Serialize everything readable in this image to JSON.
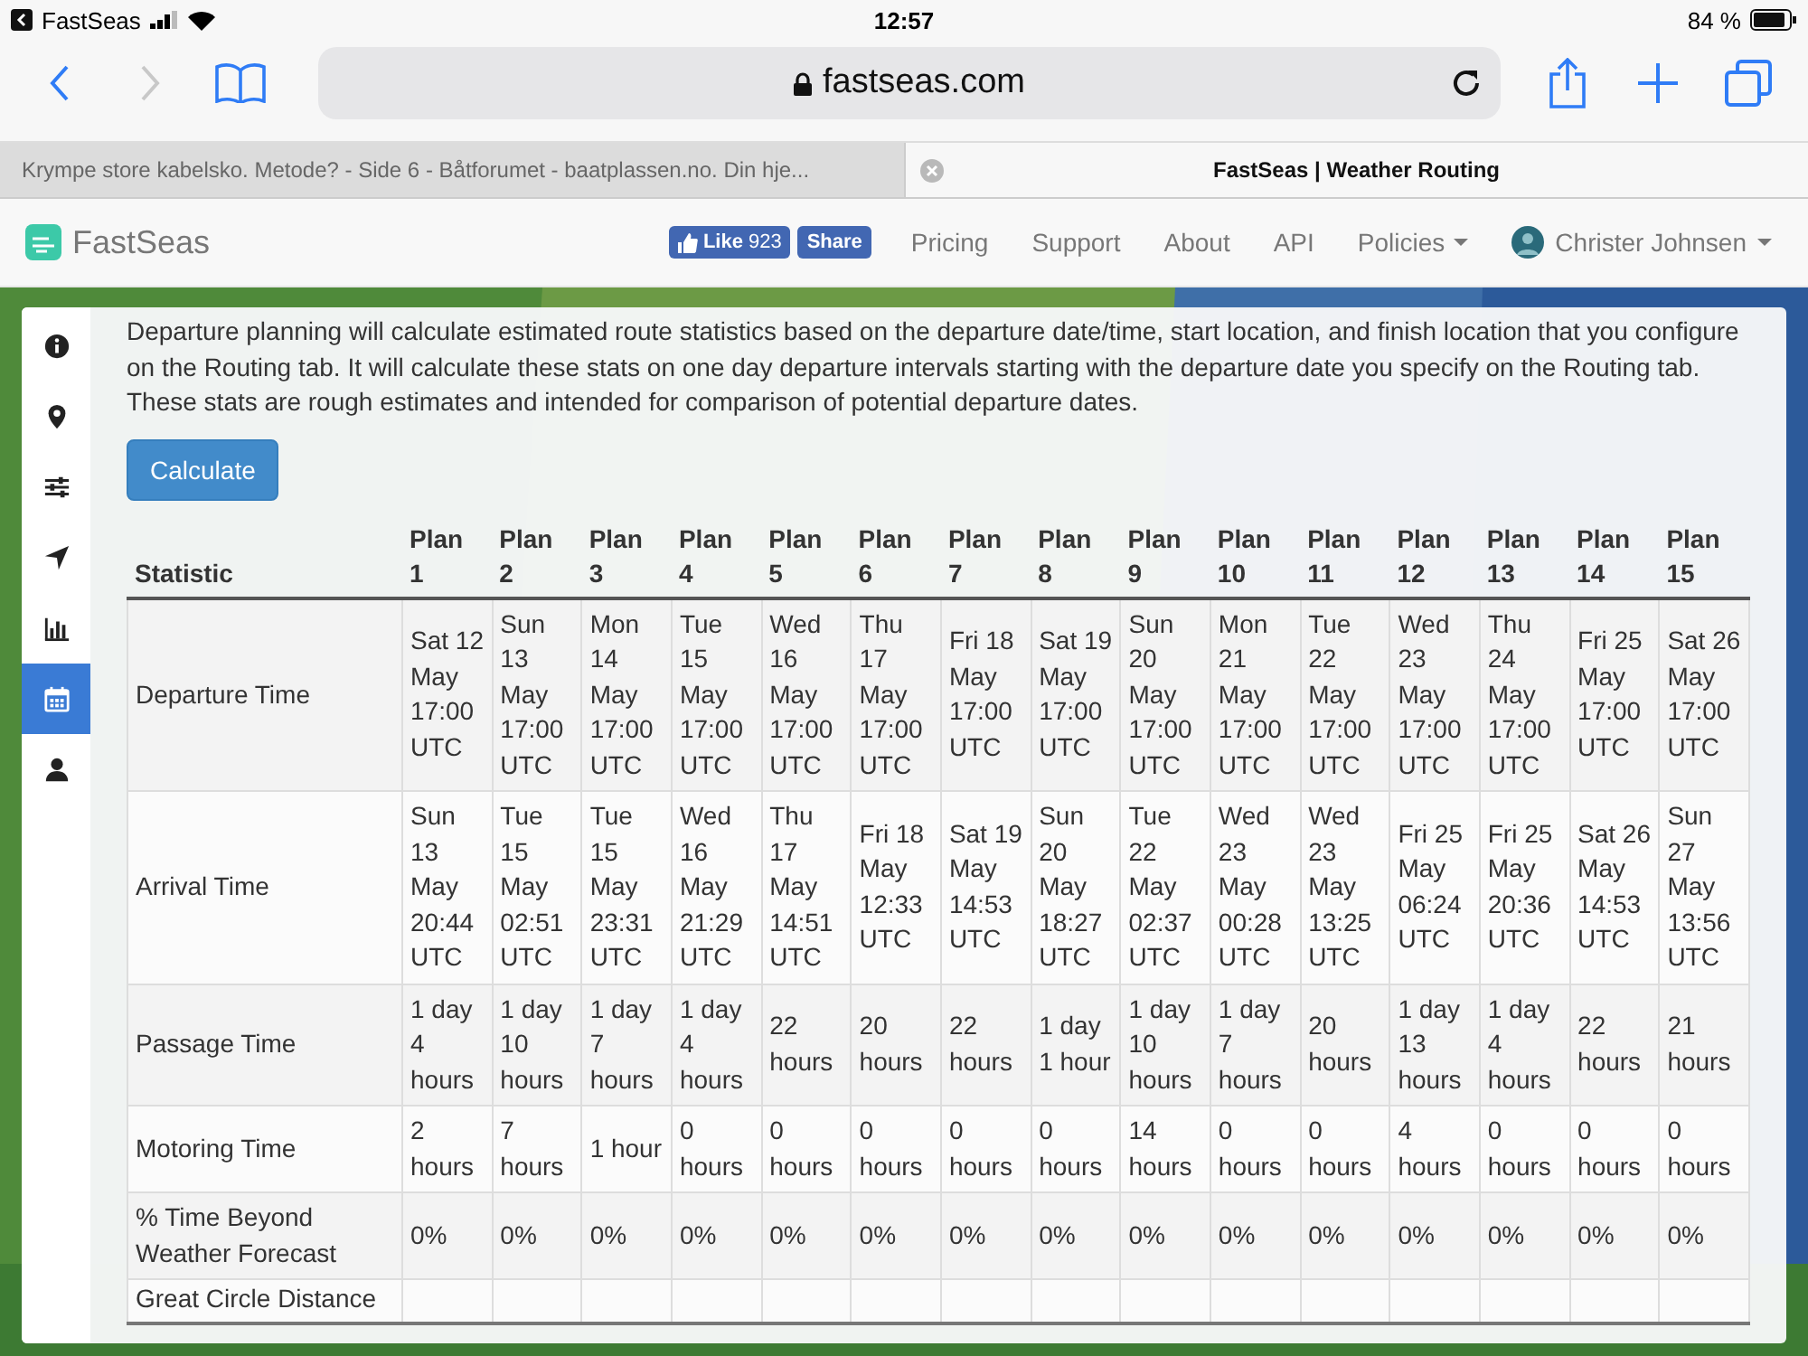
{
  "status_bar": {
    "back_app": "FastSeas",
    "time": "12:57",
    "battery": "84 %"
  },
  "browser": {
    "url": "fastseas.com",
    "tabs": [
      {
        "title": "Krympe store kabelsko. Metode? - Side 6 - Båtforumet - baatplassen.no. Din hje...",
        "selected": false
      },
      {
        "title": "FastSeas | Weather Routing",
        "selected": true
      }
    ]
  },
  "navbar": {
    "brand": "FastSeas",
    "like_label": "Like",
    "like_count": "923",
    "share_label": "Share",
    "links": [
      {
        "label": "Pricing",
        "dropdown": false
      },
      {
        "label": "Support",
        "dropdown": false
      },
      {
        "label": "About",
        "dropdown": false
      },
      {
        "label": "API",
        "dropdown": false
      },
      {
        "label": "Policies",
        "dropdown": true
      }
    ],
    "user": "Christer Johnsen"
  },
  "sidebar": {
    "items": [
      {
        "selected": false
      },
      {
        "selected": false
      },
      {
        "selected": false
      },
      {
        "selected": false
      },
      {
        "selected": false
      },
      {
        "selected": true
      },
      {
        "selected": false
      }
    ]
  },
  "description": "Departure planning will calculate estimated route statistics based on the departure date/time, start location, and finish location that you configure on the Routing tab. It will calculate these stats on one day departure intervals starting with the departure date you specify on the Routing tab. These stats are rough estimates and intended for comparison of potential departure dates.",
  "calculate_button": "Calculate",
  "table": {
    "columns": [
      "Statistic",
      "Plan 1",
      "Plan 2",
      "Plan 3",
      "Plan 4",
      "Plan 5",
      "Plan 6",
      "Plan 7",
      "Plan 8",
      "Plan 9",
      "Plan 10",
      "Plan 11",
      "Plan 12",
      "Plan 13",
      "Plan 14",
      "Plan 15"
    ],
    "rows": [
      {
        "cells": [
          "Departure Time",
          "Sat 12 May 17:00 UTC",
          "Sun 13 May 17:00 UTC",
          "Mon 14 May 17:00 UTC",
          "Tue 15 May 17:00 UTC",
          "Wed 16 May 17:00 UTC",
          "Thu 17 May 17:00 UTC",
          "Fri 18 May 17:00 UTC",
          "Sat 19 May 17:00 UTC",
          "Sun 20 May 17:00 UTC",
          "Mon 21 May 17:00 UTC",
          "Tue 22 May 17:00 UTC",
          "Wed 23 May 17:00 UTC",
          "Thu 24 May 17:00 UTC",
          "Fri 25 May 17:00 UTC",
          "Sat 26 May 17:00 UTC"
        ]
      },
      {
        "cells": [
          "Arrival Time",
          "Sun 13 May 20:44 UTC",
          "Tue 15 May 02:51 UTC",
          "Tue 15 May 23:31 UTC",
          "Wed 16 May 21:29 UTC",
          "Thu 17 May 14:51 UTC",
          "Fri 18 May 12:33 UTC",
          "Sat 19 May 14:53 UTC",
          "Sun 20 May 18:27 UTC",
          "Tue 22 May 02:37 UTC",
          "Wed 23 May 00:28 UTC",
          "Wed 23 May 13:25 UTC",
          "Fri 25 May 06:24 UTC",
          "Fri 25 May 20:36 UTC",
          "Sat 26 May 14:53 UTC",
          "Sun 27 May 13:56 UTC"
        ]
      },
      {
        "cells": [
          "Passage Time",
          "1 day 4 hours",
          "1 day 10 hours",
          "1 day 7 hours",
          "1 day 4 hours",
          "22 hours",
          "20 hours",
          "22 hours",
          "1 day 1 hour",
          "1 day 10 hours",
          "1 day 7 hours",
          "20 hours",
          "1 day 13 hours",
          "1 day 4 hours",
          "22 hours",
          "21 hours"
        ]
      },
      {
        "cells": [
          "Motoring Time",
          "2 hours",
          "7 hours",
          "1 hour",
          "0 hours",
          "0 hours",
          "0 hours",
          "0 hours",
          "0 hours",
          "14 hours",
          "0 hours",
          "0 hours",
          "4 hours",
          "0 hours",
          "0 hours",
          "0 hours"
        ]
      },
      {
        "cells": [
          "% Time Beyond Weather Forecast",
          "0%",
          "0%",
          "0%",
          "0%",
          "0%",
          "0%",
          "0%",
          "0%",
          "0%",
          "0%",
          "0%",
          "0%",
          "0%",
          "0%",
          "0%"
        ]
      },
      {
        "cells": [
          "Great Circle Distance"
        ]
      }
    ]
  }
}
